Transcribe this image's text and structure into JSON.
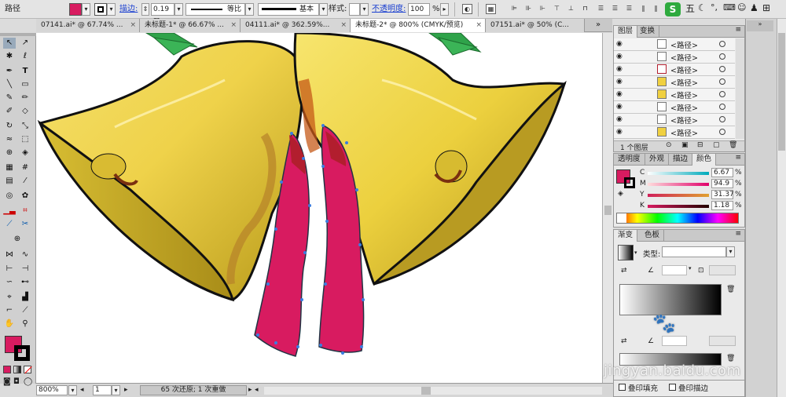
{
  "control": {
    "selection": "路径",
    "stroke_link": "描边:",
    "stroke_value": "0.19 m",
    "profile": "等比",
    "brush": "基本",
    "style_label": "样式:",
    "opacity_link": "不透明度:",
    "opacity_value": "100",
    "opacity_unit": "%",
    "fill_color": "#d81b60",
    "ime": "五"
  },
  "tabs": [
    {
      "label": "07141.ai* @ 67.74% ..."
    },
    {
      "label": "未标题-1* @ 66.67% ..."
    },
    {
      "label": "04111.ai* @ 362.59%..."
    },
    {
      "label": "未标题-2* @ 800% (CMYK/预览)"
    },
    {
      "label": "07151.ai* @ 50% (C..."
    }
  ],
  "status": {
    "zoom": "800%",
    "page": "1",
    "message": "65 次还原; 1 次重做"
  },
  "layers": {
    "tab_layers": "图层",
    "tab_transform": "变换",
    "rows": [
      {
        "name": "<路径>"
      },
      {
        "name": "<路径>"
      },
      {
        "name": "<路径>"
      },
      {
        "name": "<路径>"
      },
      {
        "name": "<路径>"
      },
      {
        "name": "<路径>"
      },
      {
        "name": "<路径>"
      },
      {
        "name": "<路径>"
      }
    ],
    "footer": "1 个图层"
  },
  "color": {
    "tabs": [
      "透明度",
      "外观",
      "描边",
      "颜色"
    ],
    "channels": [
      {
        "label": "C",
        "value": "6.67",
        "unit": "%"
      },
      {
        "label": "M",
        "value": "94.9",
        "unit": "%"
      },
      {
        "label": "Y",
        "value": "31.37",
        "unit": "%"
      },
      {
        "label": "K",
        "value": "1.18",
        "unit": "%"
      }
    ],
    "swatch": "#d81b60"
  },
  "gradient": {
    "tabs": [
      "渐变",
      "色板"
    ],
    "type_label": "类型:"
  },
  "appearance": {
    "overprint_fill": "叠印填充",
    "overprint_stroke": "叠印描边"
  },
  "watermark": "jingyan.baidu.com"
}
